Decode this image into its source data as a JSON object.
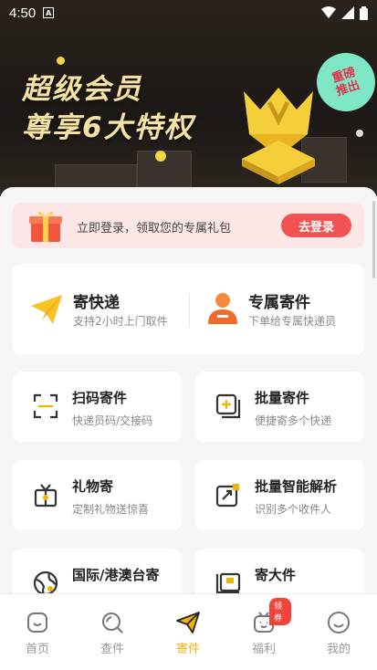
{
  "status_bar": {
    "time": "4:50",
    "a_badge": "A"
  },
  "banner": {
    "title_line1": "超级会员",
    "title_line2": "尊享6大特权",
    "badge_line1": "重磅",
    "badge_line2": "推出"
  },
  "login_bar": {
    "text": "立即登录，领取您的专属礼包",
    "button": "去登录"
  },
  "express": {
    "send": {
      "name": "寄快递",
      "sub": "支持2小时上门取件"
    },
    "exclusive": {
      "name": "专属寄件",
      "sub": "下单给专属快递员"
    }
  },
  "services": [
    {
      "name": "扫码寄件",
      "sub": "快递员码/交接码",
      "icon": "scan-icon"
    },
    {
      "name": "批量寄件",
      "sub": "便捷寄多个快递",
      "icon": "batch-icon"
    },
    {
      "name": "礼物寄",
      "sub": "定制礼物送惊喜",
      "icon": "gift-box-icon"
    },
    {
      "name": "批量智能解析",
      "sub": "识别多个收件人",
      "icon": "parse-icon"
    },
    {
      "name": "国际/港澳台寄",
      "sub": "",
      "icon": "globe-icon"
    },
    {
      "name": "寄大件",
      "sub": "",
      "icon": "large-package-icon"
    }
  ],
  "nav": {
    "items": [
      {
        "label": "首页",
        "icon": "home-icon"
      },
      {
        "label": "查件",
        "icon": "search-icon"
      },
      {
        "label": "寄件",
        "icon": "send-plane-icon"
      },
      {
        "label": "福利",
        "icon": "welfare-icon"
      },
      {
        "label": "我的",
        "icon": "profile-icon"
      }
    ],
    "badge": "领券",
    "active_index": 2
  },
  "colors": {
    "accent": "#f2b400",
    "login_button": "#f05352",
    "gold_text": "#f6e2a2"
  }
}
